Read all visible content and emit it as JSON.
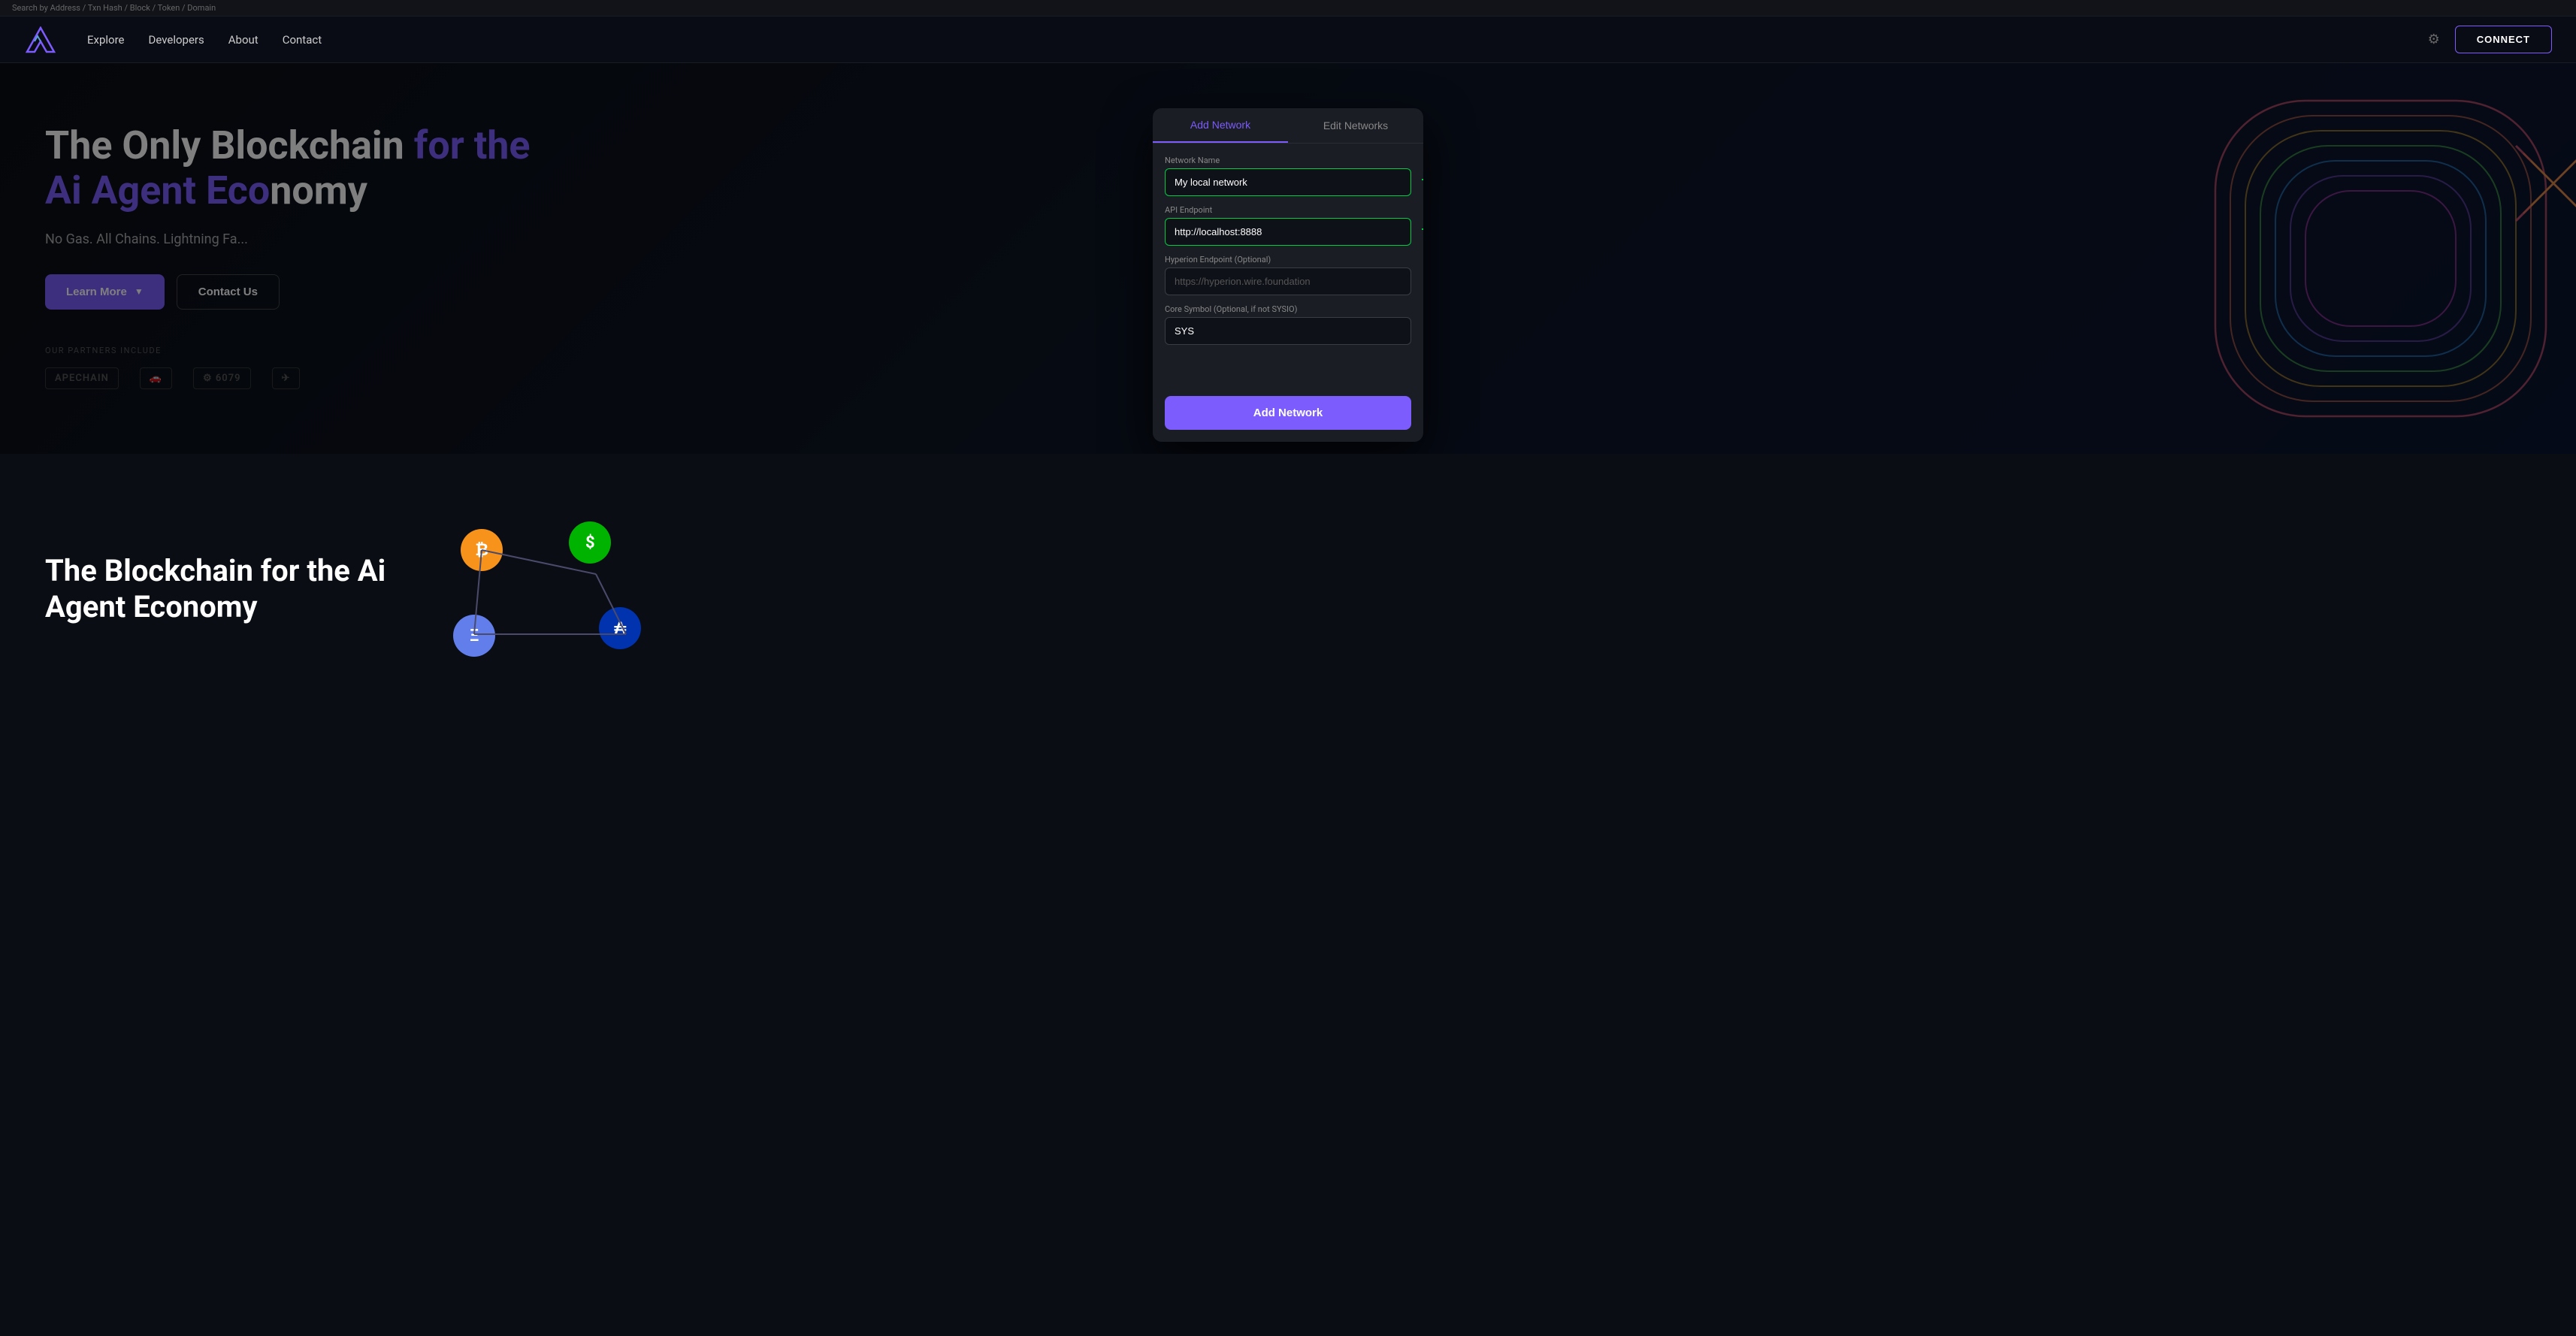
{
  "searchbar": {
    "placeholder": "Search by Address / Txn Hash / Block / Token / Domain"
  },
  "nav": {
    "explore": "Explore",
    "developers": "Developers",
    "about": "About",
    "contact": "Contact",
    "connect": "CONNECT",
    "settings_icon": "⚙"
  },
  "hero": {
    "title_line1": "The Only Blockchain",
    "title_highlight": "for the",
    "title_line2": "Ai Agent Eco",
    "title_line2_rest": "nomy",
    "subtitle": "No Gas. All Chains. Lightning Fa...",
    "learn_more": "Learn More",
    "contact_us": "Contact Us",
    "partners_label": "OUR PARTNERS INCLUDE",
    "partners": [
      "APECHAIN",
      "🚗",
      "⚙ 6079",
      "✈"
    ]
  },
  "modal": {
    "tab_add": "Add Network",
    "tab_edit": "Edit Networks",
    "fields": {
      "network_name_label": "Network Name",
      "network_name_value": "My local network",
      "api_endpoint_label": "API Endpoint",
      "api_endpoint_value": "http://localhost:8888",
      "hyperion_label": "Hyperion Endpoint (Optional)",
      "hyperion_placeholder": "https://hyperion.wire.foundation",
      "core_symbol_label": "Core Symbol (Optional, if not SYSIO)",
      "core_symbol_value": "SYS"
    },
    "add_button": "Add Network"
  },
  "bottom": {
    "title_line1": "The Blockchain for the Ai",
    "title_line2": "Agent Economy"
  }
}
